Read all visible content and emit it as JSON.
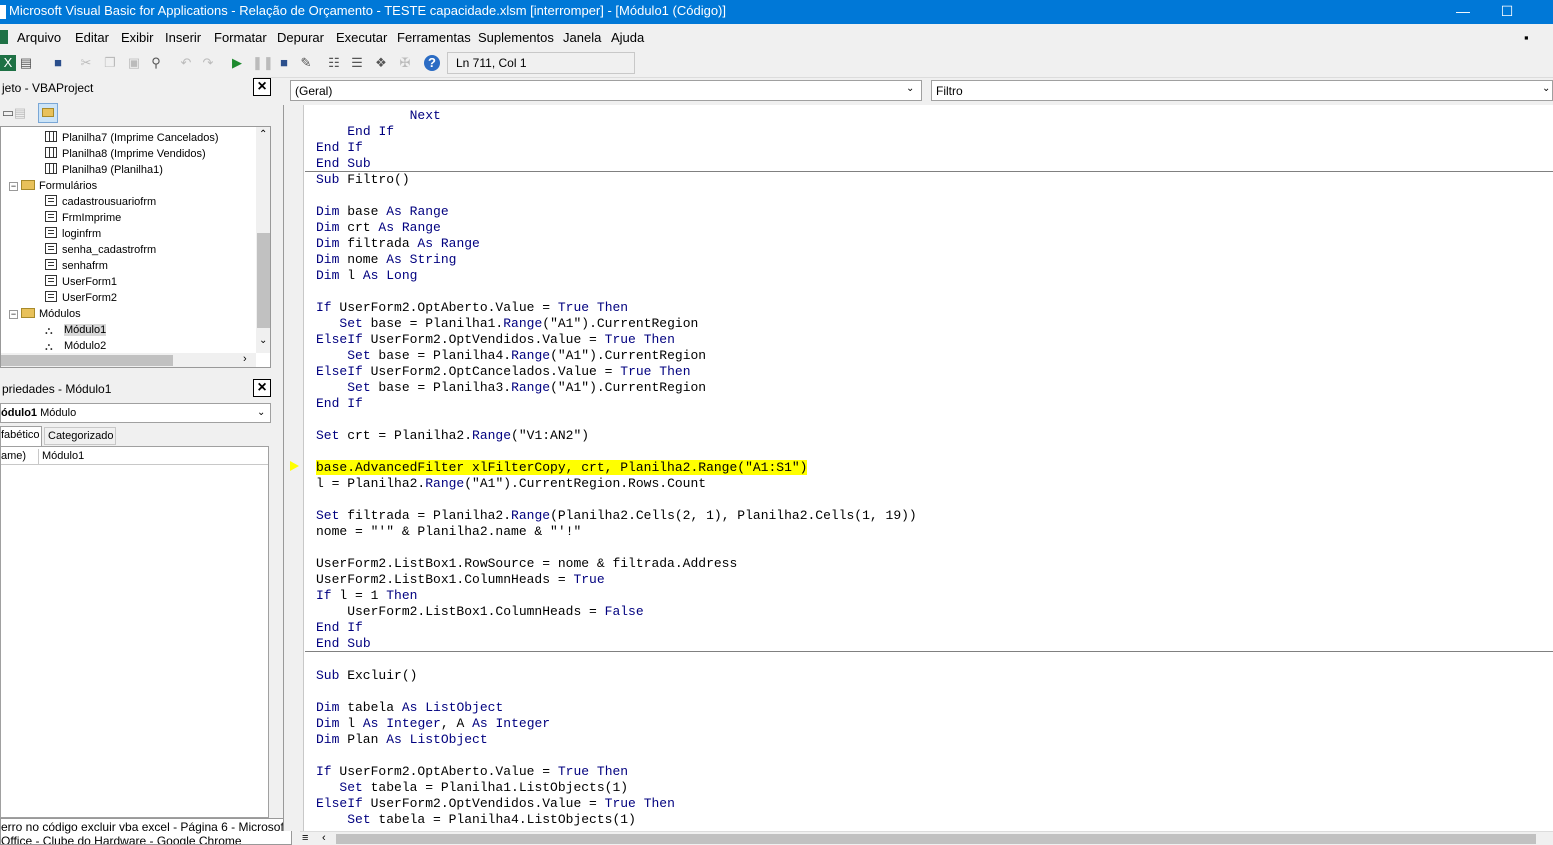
{
  "window": {
    "title": "Microsoft Visual Basic for Applications - Relação de Orçamento - TESTE capacidade.xlsm [interromper] - [Módulo1 (Código)]",
    "minimize": "—",
    "maximize": "☐"
  },
  "menu": {
    "items": [
      "Arquivo",
      "Editar",
      "Exibir",
      "Inserir",
      "Formatar",
      "Depurar",
      "Executar",
      "Ferramentas",
      "Suplementos",
      "Janela",
      "Ajuda"
    ],
    "restore": "▪"
  },
  "toolbar": {
    "position_label": "Ln 711, Col 1"
  },
  "project": {
    "title": "jeto - VBAProject",
    "tree": [
      {
        "label": "Planilha7 (Imprime Cancelados)",
        "kind": "sheet"
      },
      {
        "label": "Planilha8 (Imprime Vendidos)",
        "kind": "sheet"
      },
      {
        "label": "Planilha9 (Planilha1)",
        "kind": "sheet"
      },
      {
        "label": "Formulários",
        "kind": "folder"
      },
      {
        "label": "cadastrousuariofrm",
        "kind": "form"
      },
      {
        "label": "FrmImprime",
        "kind": "form"
      },
      {
        "label": "loginfrm",
        "kind": "form"
      },
      {
        "label": "senha_cadastrofrm",
        "kind": "form"
      },
      {
        "label": "senhafrm",
        "kind": "form"
      },
      {
        "label": "UserForm1",
        "kind": "form"
      },
      {
        "label": "UserForm2",
        "kind": "form"
      },
      {
        "label": "Módulos",
        "kind": "folder"
      },
      {
        "label": "Módulo1",
        "kind": "module"
      },
      {
        "label": "Módulo2",
        "kind": "module"
      }
    ]
  },
  "properties": {
    "title": "priedades - Módulo1",
    "object_name": "ódulo1",
    "object_type": "Módulo",
    "tab_alpha": "fabético",
    "tab_cat": "Categorizado",
    "prop_name": "ame)",
    "prop_value": "Módulo1"
  },
  "taskbar_tip": {
    "line1": "erro no código excluir vba excel - Página 6 - Microsoft",
    "line2": "Office - Clube do Hardware - Google Chrome"
  },
  "code": {
    "object_combo": "(Geral)",
    "proc_combo": "Filtro",
    "current_line_index": 22,
    "lines": [
      "            Next",
      "    End If",
      "End If",
      "End Sub",
      "Sub Filtro()",
      "",
      "Dim base As Range",
      "Dim crt As Range",
      "Dim filtrada As Range",
      "Dim nome As String",
      "Dim l As Long",
      "",
      "If UserForm2.OptAberto.Value = True Then",
      "   Set base = Planilha1.Range(\"A1\").CurrentRegion",
      "ElseIf UserForm2.OptVendidos.Value = True Then",
      "    Set base = Planilha4.Range(\"A1\").CurrentRegion",
      "ElseIf UserForm2.OptCancelados.Value = True Then",
      "    Set base = Planilha3.Range(\"A1\").CurrentRegion",
      "End If",
      "",
      "Set crt = Planilha2.Range(\"V1:AN2\")",
      "",
      "base.AdvancedFilter xlFilterCopy, crt, Planilha2.Range(\"A1:S1\")",
      "l = Planilha2.Range(\"A1\").CurrentRegion.Rows.Count",
      "",
      "Set filtrada = Planilha2.Range(Planilha2.Cells(2, 1), Planilha2.Cells(1, 19))",
      "nome = \"'\" & Planilha2.name & \"'!\"",
      "",
      "UserForm2.ListBox1.RowSource = nome & filtrada.Address",
      "UserForm2.ListBox1.ColumnHeads = True",
      "If l = 1 Then",
      "    UserForm2.ListBox1.ColumnHeads = False",
      "End If",
      "End Sub",
      "",
      "Sub Excluir()",
      "",
      "Dim tabela As ListObject",
      "Dim l As Integer, A As Integer",
      "Dim Plan As ListObject",
      "",
      "If UserForm2.OptAberto.Value = True Then",
      "   Set tabela = Planilha1.ListObjects(1)",
      "ElseIf UserForm2.OptVendidos.Value = True Then",
      "    Set tabela = Planilha4.ListObjects(1)"
    ],
    "separators_after": [
      3,
      33
    ]
  },
  "colors": {
    "keyword": "#00007f",
    "highlight": "#ffff00",
    "titlebar": "#0078d7"
  }
}
